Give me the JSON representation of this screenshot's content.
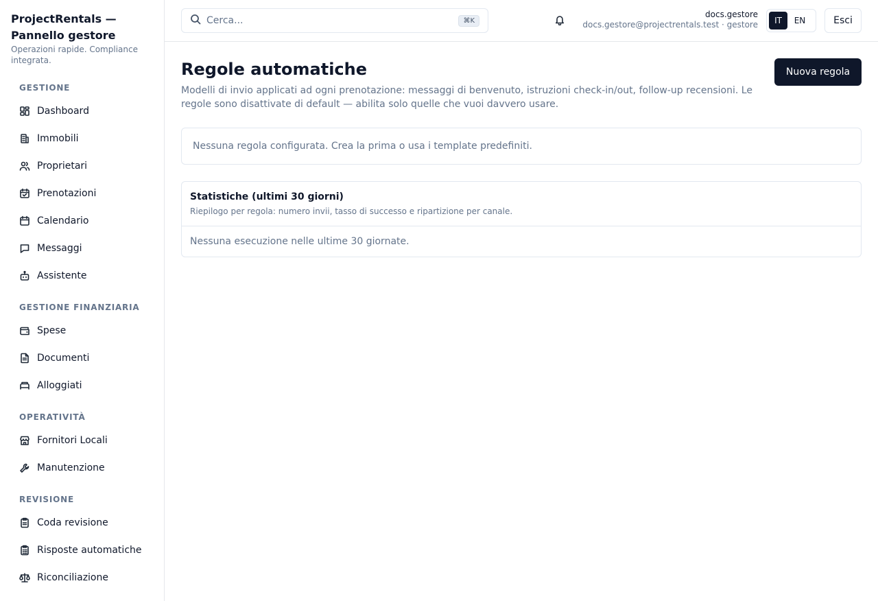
{
  "brand": {
    "title": "ProjectRentals — Pannello gestore",
    "subtitle": "Operazioni rapide. Compliance integrata."
  },
  "sidebar": {
    "sections": [
      {
        "title": "GESTIONE",
        "items": [
          {
            "label": "Dashboard",
            "icon": "dashboard-icon"
          },
          {
            "label": "Immobili",
            "icon": "building-icon"
          },
          {
            "label": "Proprietari",
            "icon": "users-icon"
          },
          {
            "label": "Prenotazioni",
            "icon": "calendar-check-icon"
          },
          {
            "label": "Calendario",
            "icon": "calendar-icon"
          },
          {
            "label": "Messaggi",
            "icon": "message-icon"
          },
          {
            "label": "Assistente",
            "icon": "bot-icon"
          }
        ]
      },
      {
        "title": "GESTIONE FINANZIARIA",
        "items": [
          {
            "label": "Spese",
            "icon": "wallet-icon"
          },
          {
            "label": "Documenti",
            "icon": "document-icon"
          },
          {
            "label": "Alloggiati",
            "icon": "bed-icon"
          }
        ]
      },
      {
        "title": "OPERATIVITÀ",
        "items": [
          {
            "label": "Fornitori Locali",
            "icon": "store-icon"
          },
          {
            "label": "Manutenzione",
            "icon": "wrench-icon"
          }
        ]
      },
      {
        "title": "REVISIONE",
        "items": [
          {
            "label": "Coda revisione",
            "icon": "clipboard-icon"
          },
          {
            "label": "Risposte automatiche",
            "icon": "clipboard-list-icon"
          },
          {
            "label": "Riconciliazione",
            "icon": "scale-icon"
          }
        ]
      }
    ]
  },
  "header": {
    "search_placeholder": "Cerca...",
    "search_shortcut": "⌘K",
    "user_name": "docs.gestore",
    "user_meta": "docs.gestore@projectrentals.test · gestore",
    "lang_it": "IT",
    "lang_en": "EN",
    "logout_label": "Esci"
  },
  "main": {
    "title": "Regole automatiche",
    "description": "Modelli di invio applicati ad ogni prenotazione: messaggi di benvenuto, istruzioni check-in/out, follow-up recensioni. Le regole sono disattivate di default — abilita solo quelle che vuoi davvero usare.",
    "new_rule_label": "Nuova regola",
    "empty_rules": "Nessuna regola configurata. Crea la prima o usa i template predefiniti.",
    "stats": {
      "title": "Statistiche (ultimi 30 giorni)",
      "subtitle": "Riepilogo per regola: numero invii, tasso di successo e ripartizione per canale.",
      "empty": "Nessuna esecuzione nelle ultime 30 giornate."
    }
  }
}
